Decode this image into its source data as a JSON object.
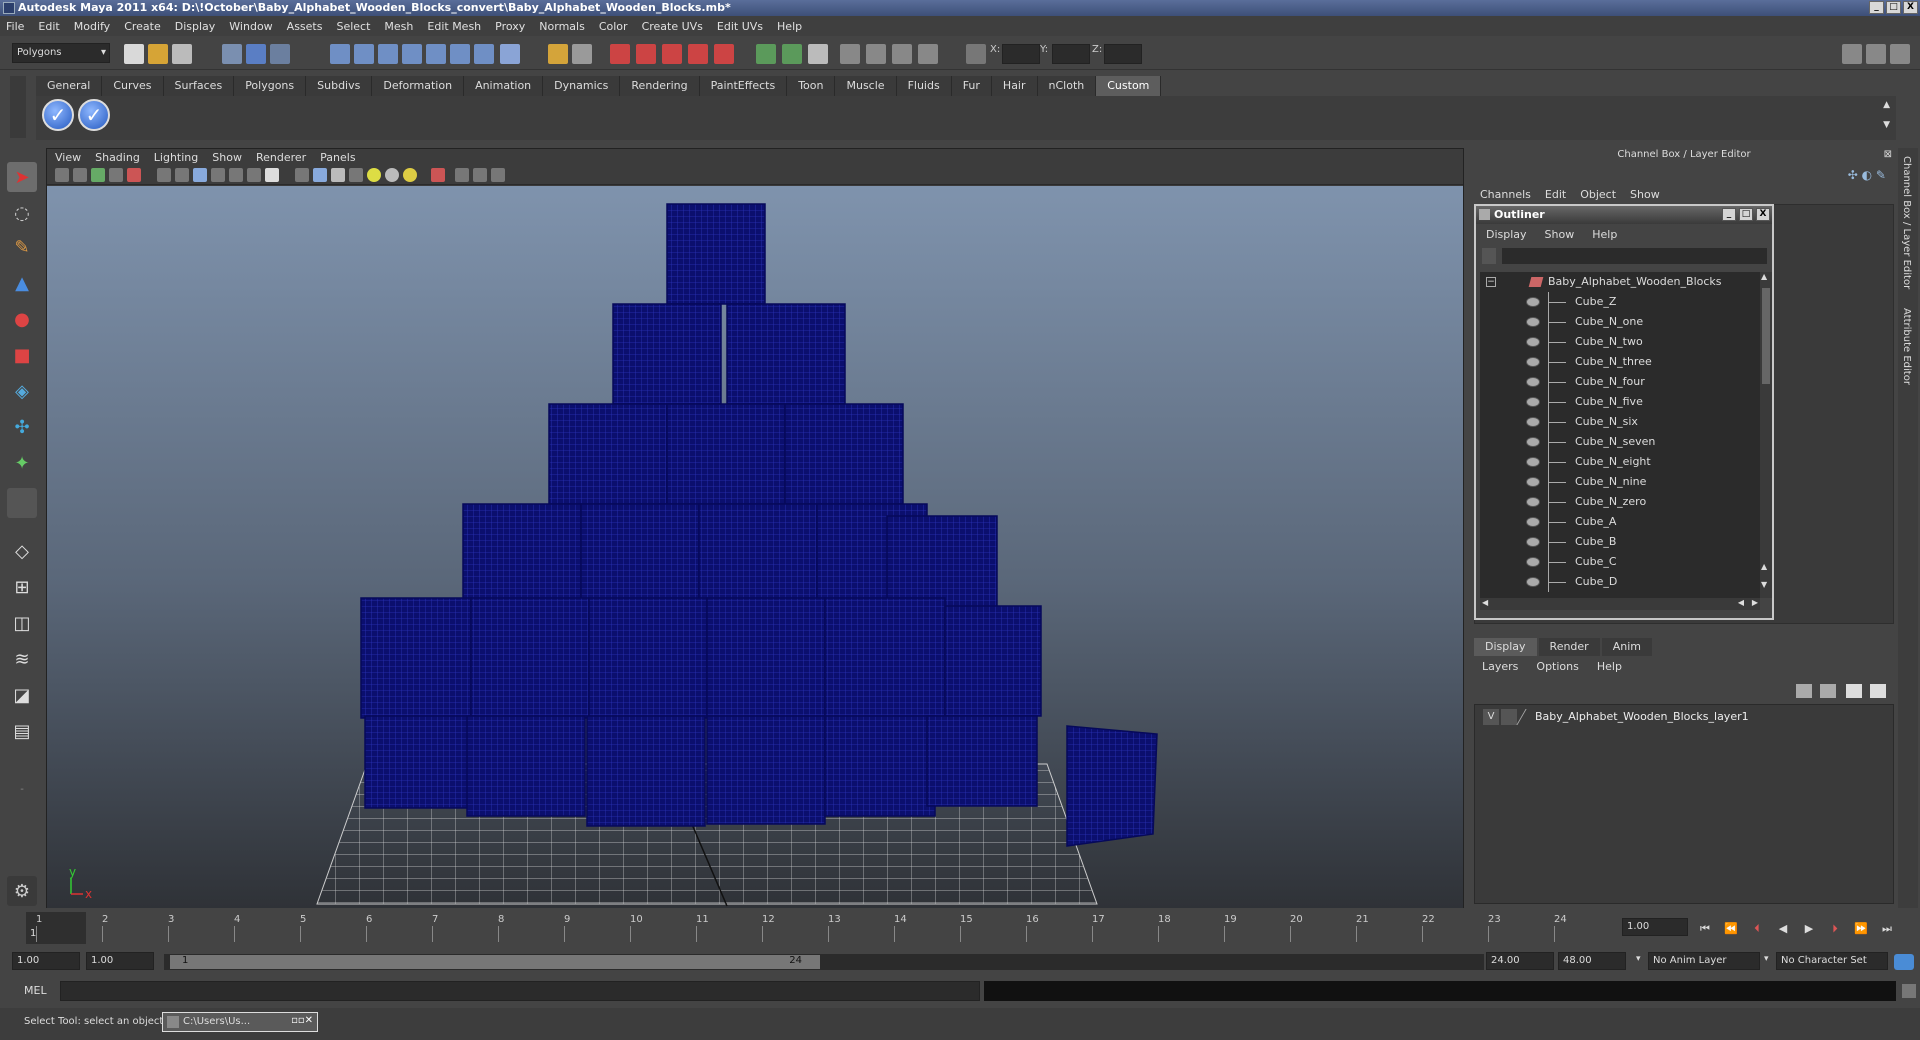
{
  "window": {
    "title": "Autodesk Maya 2011 x64: D:\\!October\\Baby_Alphabet_Wooden_Blocks_convert\\Baby_Alphabet_Wooden_Blocks.mb*",
    "controls": {
      "minimize": "_",
      "maximize": "□",
      "close": "X"
    }
  },
  "menubar": [
    "File",
    "Edit",
    "Modify",
    "Create",
    "Display",
    "Window",
    "Assets",
    "Select",
    "Mesh",
    "Edit Mesh",
    "Proxy",
    "Normals",
    "Color",
    "Create UVs",
    "Edit UVs",
    "Help"
  ],
  "statusline": {
    "mode": "Polygons",
    "coord_labels": {
      "x": "X:",
      "y": "Y:",
      "z": "Z:"
    }
  },
  "shelf": {
    "tabs": [
      "General",
      "Curves",
      "Surfaces",
      "Polygons",
      "Subdivs",
      "Deformation",
      "Animation",
      "Dynamics",
      "Rendering",
      "PaintEffects",
      "Toon",
      "Muscle",
      "Fluids",
      "Fur",
      "Hair",
      "nCloth",
      "Custom"
    ],
    "active_tab": "Custom",
    "button_glyph": "✓"
  },
  "viewport": {
    "menu": [
      "View",
      "Shading",
      "Lighting",
      "Show",
      "Renderer",
      "Panels"
    ],
    "axis": {
      "y": "y",
      "x": "x"
    }
  },
  "channel_box": {
    "title": "Channel Box / Layer Editor",
    "menu": [
      "Channels",
      "Edit",
      "Object",
      "Show"
    ],
    "side_tabs": [
      "Channel Box / Layer Editor",
      "Attribute Editor"
    ]
  },
  "outliner": {
    "title": "Outliner",
    "menu": [
      "Display",
      "Show",
      "Help"
    ],
    "root": "Baby_Alphabet_Wooden_Blocks",
    "items": [
      "Cube_Z",
      "Cube_N_one",
      "Cube_N_two",
      "Cube_N_three",
      "Cube_N_four",
      "Cube_N_five",
      "Cube_N_six",
      "Cube_N_seven",
      "Cube_N_eight",
      "Cube_N_nine",
      "Cube_N_zero",
      "Cube_A",
      "Cube_B",
      "Cube_C",
      "Cube_D"
    ]
  },
  "layer_editor": {
    "tabs": [
      "Display",
      "Render",
      "Anim"
    ],
    "active_tab": "Display",
    "menu": [
      "Layers",
      "Options",
      "Help"
    ],
    "layer": {
      "visibility": "V",
      "name": "Baby_Alphabet_Wooden_Blocks_layer1"
    }
  },
  "timeline": {
    "ticks": [
      "1",
      "2",
      "3",
      "4",
      "5",
      "6",
      "7",
      "8",
      "9",
      "10",
      "11",
      "12",
      "13",
      "14",
      "15",
      "16",
      "17",
      "18",
      "19",
      "20",
      "21",
      "22",
      "23",
      "24"
    ],
    "current_frame_marker": "1",
    "current_time": "1.00"
  },
  "range": {
    "start_time": "1.00",
    "playback_start": "1.00",
    "slider_start": "1",
    "slider_end": "24",
    "playback_end": "24.00",
    "end_time": "48.00",
    "anim_layer": "No Anim Layer",
    "character_set": "No Character Set"
  },
  "command_line": {
    "label": "MEL"
  },
  "status_bar": {
    "help_text": "Select Tool: select an object",
    "taskbar_item": "C:\\Users\\Us..."
  }
}
